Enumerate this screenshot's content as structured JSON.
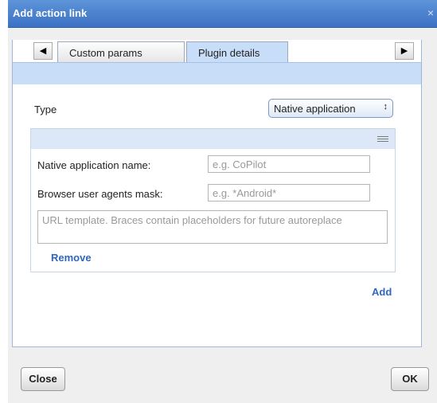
{
  "dialog": {
    "title": "Add action link",
    "close_glyph": "×"
  },
  "tabs": [
    {
      "label": "Custom params",
      "active": false
    },
    {
      "label": "Plugin details",
      "active": true
    }
  ],
  "type": {
    "label": "Type",
    "selected": "Native application",
    "select_arrow": "↕"
  },
  "fields": {
    "native_name": {
      "label": "Native application name:",
      "placeholder": "e.g. CoPilot"
    },
    "ua_mask": {
      "label": "Browser user agents mask:",
      "placeholder": "e.g. *Android*"
    },
    "url_template": {
      "placeholder": "URL template. Braces contain placeholders for future autoreplace"
    }
  },
  "links": {
    "remove": "Remove",
    "add": "Add"
  },
  "buttons": {
    "close": "Close",
    "ok": "OK"
  },
  "icons": {
    "left": "◀",
    "right": "▶"
  }
}
